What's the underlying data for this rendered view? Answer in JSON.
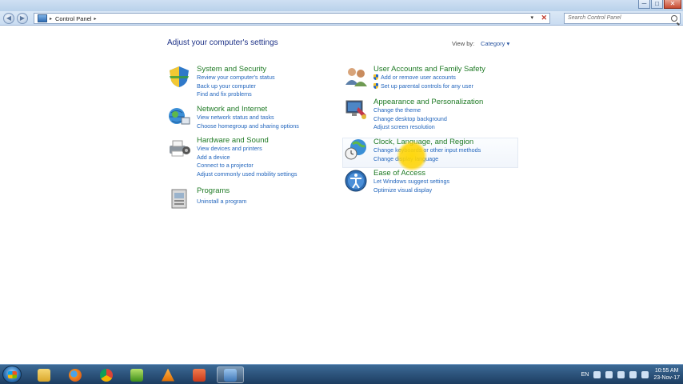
{
  "window": {
    "close_glyph": "✕",
    "minimize_glyph": "─",
    "maximize_glyph": "□"
  },
  "nav": {
    "back_glyph": "◀",
    "forward_glyph": "▶",
    "breadcrumb": "Control Panel",
    "crumb_arrow": "▸",
    "dropdown_glyph": "▾",
    "clear_glyph": "✕",
    "search_placeholder": "Search Control Panel"
  },
  "content": {
    "heading": "Adjust your computer's settings",
    "view_by_label": "View by:",
    "view_by_value": "Category ▾"
  },
  "categories": {
    "system_security": {
      "title": "System and Security",
      "links": [
        "Review your computer's status",
        "Back up your computer",
        "Find and fix problems"
      ]
    },
    "network_internet": {
      "title": "Network and Internet",
      "links": [
        "View network status and tasks",
        "Choose homegroup and sharing options"
      ]
    },
    "hardware_sound": {
      "title": "Hardware and Sound",
      "links": [
        "View devices and printers",
        "Add a device",
        "Connect to a projector",
        "Adjust commonly used mobility settings"
      ]
    },
    "programs": {
      "title": "Programs",
      "links": [
        "Uninstall a program"
      ]
    },
    "user_accounts": {
      "title": "User Accounts and Family Safety",
      "links": [
        "Add or remove user accounts",
        "Set up parental controls for any user"
      ]
    },
    "appearance": {
      "title": "Appearance and Personalization",
      "links": [
        "Change the theme",
        "Change desktop background",
        "Adjust screen resolution"
      ]
    },
    "clock_region": {
      "title": "Clock, Language, and Region",
      "links": [
        "Change keyboards or other input methods",
        "Change display language"
      ]
    },
    "ease_access": {
      "title": "Ease of Access",
      "links": [
        "Let Windows suggest settings",
        "Optimize visual display"
      ]
    }
  },
  "taskbar": {
    "apps": [
      "explorer-icon",
      "firefox-icon",
      "chrome-icon",
      "spreadsheet-icon",
      "vlc-icon",
      "media-icon",
      "control-panel-icon"
    ],
    "language": "EN",
    "time": "10:55 AM",
    "date": "23-Nov-17"
  },
  "colors": {
    "category_title": "#1f7a25",
    "link": "#2366bd",
    "heading": "#1e3287",
    "cursor_highlight": "#ffd600"
  }
}
